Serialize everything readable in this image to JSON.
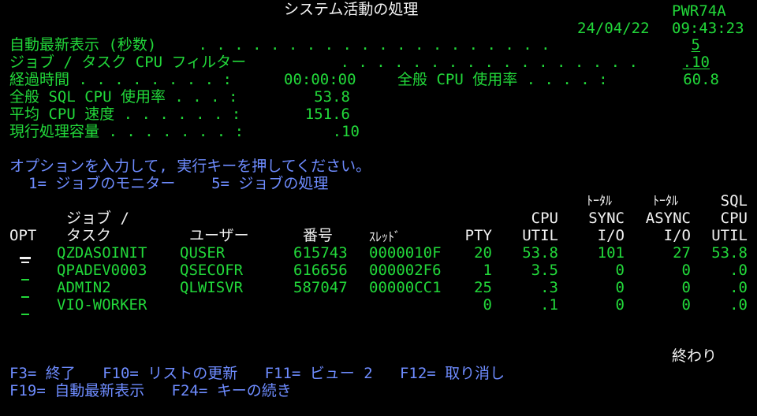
{
  "header": {
    "title": "システム活動の処理",
    "system": "PWR74A",
    "date": "24/04/22",
    "time": "09:43:23"
  },
  "fields": {
    "auto_refresh_label": "自動最新表示 (秒数)",
    "auto_refresh_dots": " . . . . . . . . . . . . . . . . . . . .",
    "auto_refresh_value": "5",
    "cpu_filter_label": "ジョブ / タスク CPU フィルター",
    "cpu_filter_dots": " . . . . . . . . . . . . . . . . .",
    "cpu_filter_value": ".10",
    "elapsed_label": "経過時間 . . . . . . . . :",
    "elapsed_value": "00:00:00",
    "overall_cpu_label": "全般 CPU 使用率 . . . . :",
    "overall_cpu_value": "60.8",
    "sql_cpu_label": "全般 SQL CPU 使用率 . . . :",
    "sql_cpu_value": "53.8",
    "avg_cpu_label": "平均 CPU 速度 . . . . . . :",
    "avg_cpu_value": "151.6",
    "capacity_label": "現行処理容量 . . . . . . . :",
    "capacity_value": ".10"
  },
  "instructions": {
    "prompt": "オプションを入力して, 実行キーを押してください。",
    "options": "1= ジョブのモニター    5= ジョブの処理"
  },
  "table": {
    "headers": {
      "opt": "OPT",
      "job_line1": "ジョブ /",
      "job_line2": "タスク",
      "user": "ユーザー",
      "number": "番号",
      "thread": "ｽﾚｯﾄﾞ",
      "pty": "PTY",
      "cpu_line1": "CPU",
      "cpu_line2": "UTIL",
      "sync_line0": "ﾄｰﾀﾙ",
      "sync_line1": "SYNC",
      "sync_line2": "I/O",
      "async_line0": "ﾄｰﾀﾙ",
      "async_line1": "ASYNC",
      "async_line2": "I/O",
      "sql_line0": "SQL",
      "sql_line1": "CPU",
      "sql_line2": "UTIL"
    },
    "rows": [
      {
        "job": "QZDASOINIT",
        "user": "QUSER",
        "number": "615743",
        "thread": "0000010F",
        "pty": "20",
        "cpu": "53.8",
        "sync": "101",
        "async": "27",
        "sql": "53.8"
      },
      {
        "job": "QPADEV0003",
        "user": "QSECOFR",
        "number": "616656",
        "thread": "000002F6",
        "pty": "1",
        "cpu": "3.5",
        "sync": "0",
        "async": "0",
        "sql": ".0"
      },
      {
        "job": "ADMIN2",
        "user": "QLWISVR",
        "number": "587047",
        "thread": "00000CC1",
        "pty": "25",
        "cpu": ".3",
        "sync": "0",
        "async": "0",
        "sql": ".0"
      },
      {
        "job": "VIO-WORKER",
        "user": "",
        "number": "",
        "thread": "",
        "pty": "0",
        "cpu": ".1",
        "sync": "0",
        "async": "0",
        "sql": ".0"
      }
    ]
  },
  "footer": {
    "end_text": "終わり",
    "fkeys_line1": "F3= 終了   F10= リストの更新   F11= ビュー 2   F12= 取り消し",
    "fkeys_line2": "F19= 自動最新表示   F24= キーの続き"
  },
  "colors": {
    "background": "#000000",
    "green": "#22d83a",
    "white": "#f2f2f2",
    "blue": "#6e8cff"
  }
}
